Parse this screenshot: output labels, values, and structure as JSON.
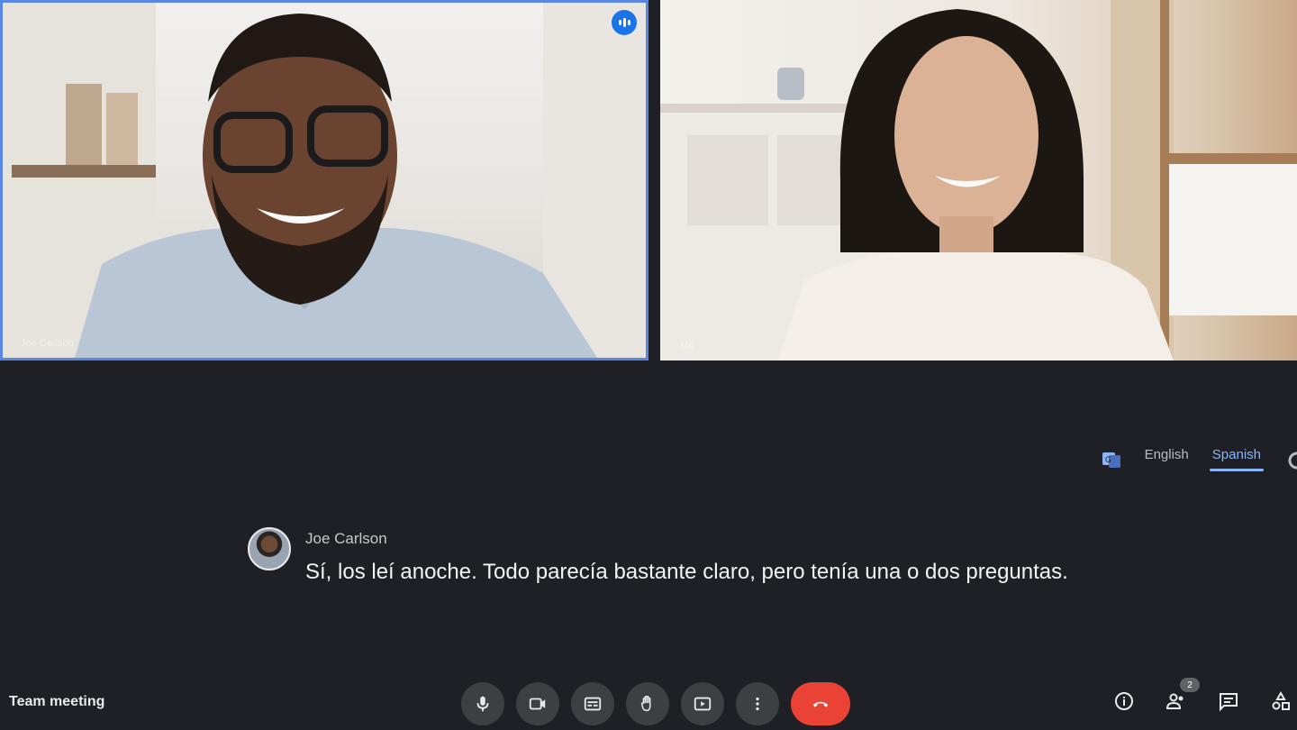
{
  "tiles": [
    {
      "name": "Joe Carlson",
      "speaking": true
    },
    {
      "name": "Me"
    }
  ],
  "captions": {
    "languages": [
      "English",
      "Spanish"
    ],
    "active_language": "Spanish",
    "speaker": "Joe Carlson",
    "text": "Sí, los leí anoche. Todo parecía bastante claro, pero tenía una o dos preguntas."
  },
  "toolbar": {
    "meeting_title": "Team meeting",
    "participants_count": "2",
    "controls": [
      {
        "name": "microphone-button",
        "icon": "mic-icon"
      },
      {
        "name": "camera-button",
        "icon": "videocam-icon"
      },
      {
        "name": "captions-button",
        "icon": "captions-icon"
      },
      {
        "name": "raise-hand-button",
        "icon": "hand-icon"
      },
      {
        "name": "present-button",
        "icon": "present-screen-icon"
      },
      {
        "name": "more-options-button",
        "icon": "more-vert-icon"
      },
      {
        "name": "end-call-button",
        "icon": "end-call-icon"
      }
    ],
    "right_tools": [
      "info-icon",
      "people-icon",
      "chat-icon",
      "activities-icon"
    ],
    "colors": {
      "accent": "#8ab4f8",
      "end_call": "#ea4335",
      "background": "#1e2025",
      "speaking_border": "#5a86e6"
    }
  }
}
